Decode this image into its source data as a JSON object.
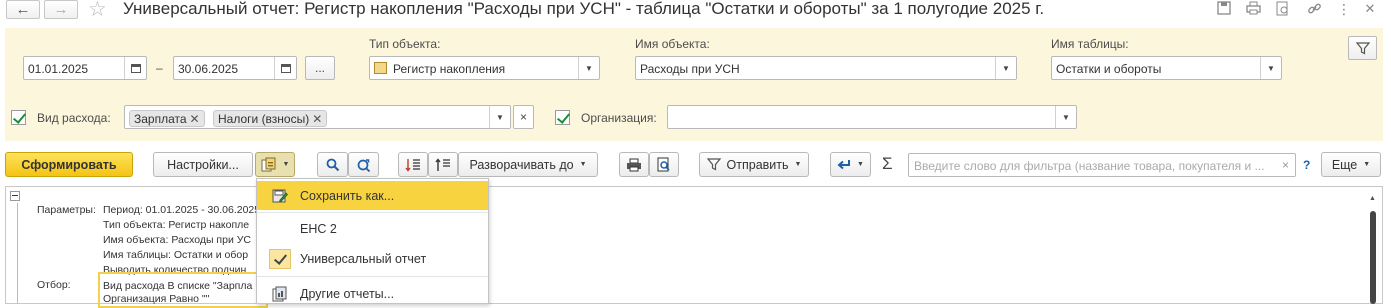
{
  "title": "Универсальный отчет: Регистр накопления \"Расходы при УСН\" - таблица \"Остатки и обороты\" за 1 полугодие 2025 г.",
  "nav": {
    "back": "←",
    "forward": "→"
  },
  "period": {
    "from": "01.01.2025",
    "separator": "–",
    "to": "30.06.2025",
    "more": "..."
  },
  "object_type": {
    "label": "Тип объекта:",
    "value": "Регистр накопления"
  },
  "object_name": {
    "label": "Имя объекта:",
    "value": "Расходы при УСН"
  },
  "table_name": {
    "label": "Имя таблицы:",
    "value": "Остатки и обороты"
  },
  "expense_kind": {
    "label": "Вид расхода:",
    "tags": [
      "Зарплата",
      "Налоги (взносы)"
    ],
    "clear": "×"
  },
  "organization": {
    "label": "Организация:",
    "value": ""
  },
  "toolbar": {
    "generate": "Сформировать",
    "settings": "Настройки...",
    "expand_to": "Разворачивать до",
    "send": "Отправить",
    "sigma": "Σ",
    "search_placeholder": "Введите слово для фильтра (название товара, покупателя и ...",
    "search_clear": "×",
    "help": "?",
    "more": "Еще"
  },
  "menu": {
    "items": [
      {
        "label": "Сохранить как...",
        "selected": true,
        "icon": "save-as-icon"
      },
      {
        "label": "ЕНС 2",
        "selected": false,
        "icon": ""
      },
      {
        "label": "Универсальный отчет",
        "selected": false,
        "icon": "checkmark-icon"
      },
      {
        "label": "Другие отчеты...",
        "selected": false,
        "icon": "reports-icon"
      }
    ]
  },
  "report": {
    "params_label": "Параметры:",
    "params": [
      "Период: 01.01.2025 - 30.06.2025",
      "Тип объекта: Регистр накопле",
      "Имя объекта: Расходы при УС",
      "Имя таблицы: Остатки и обор",
      "Выводить количество подчин"
    ],
    "filter_label": "Отбор:",
    "filter": [
      "Вид расхода В списке \"Зарпла",
      "Организация Равно \"\""
    ]
  },
  "colors": {
    "panel_bg": "#fbf6dc",
    "primary": "#f4c414",
    "menu_highlight": "#f8d340",
    "check": "#1c8e3a"
  }
}
